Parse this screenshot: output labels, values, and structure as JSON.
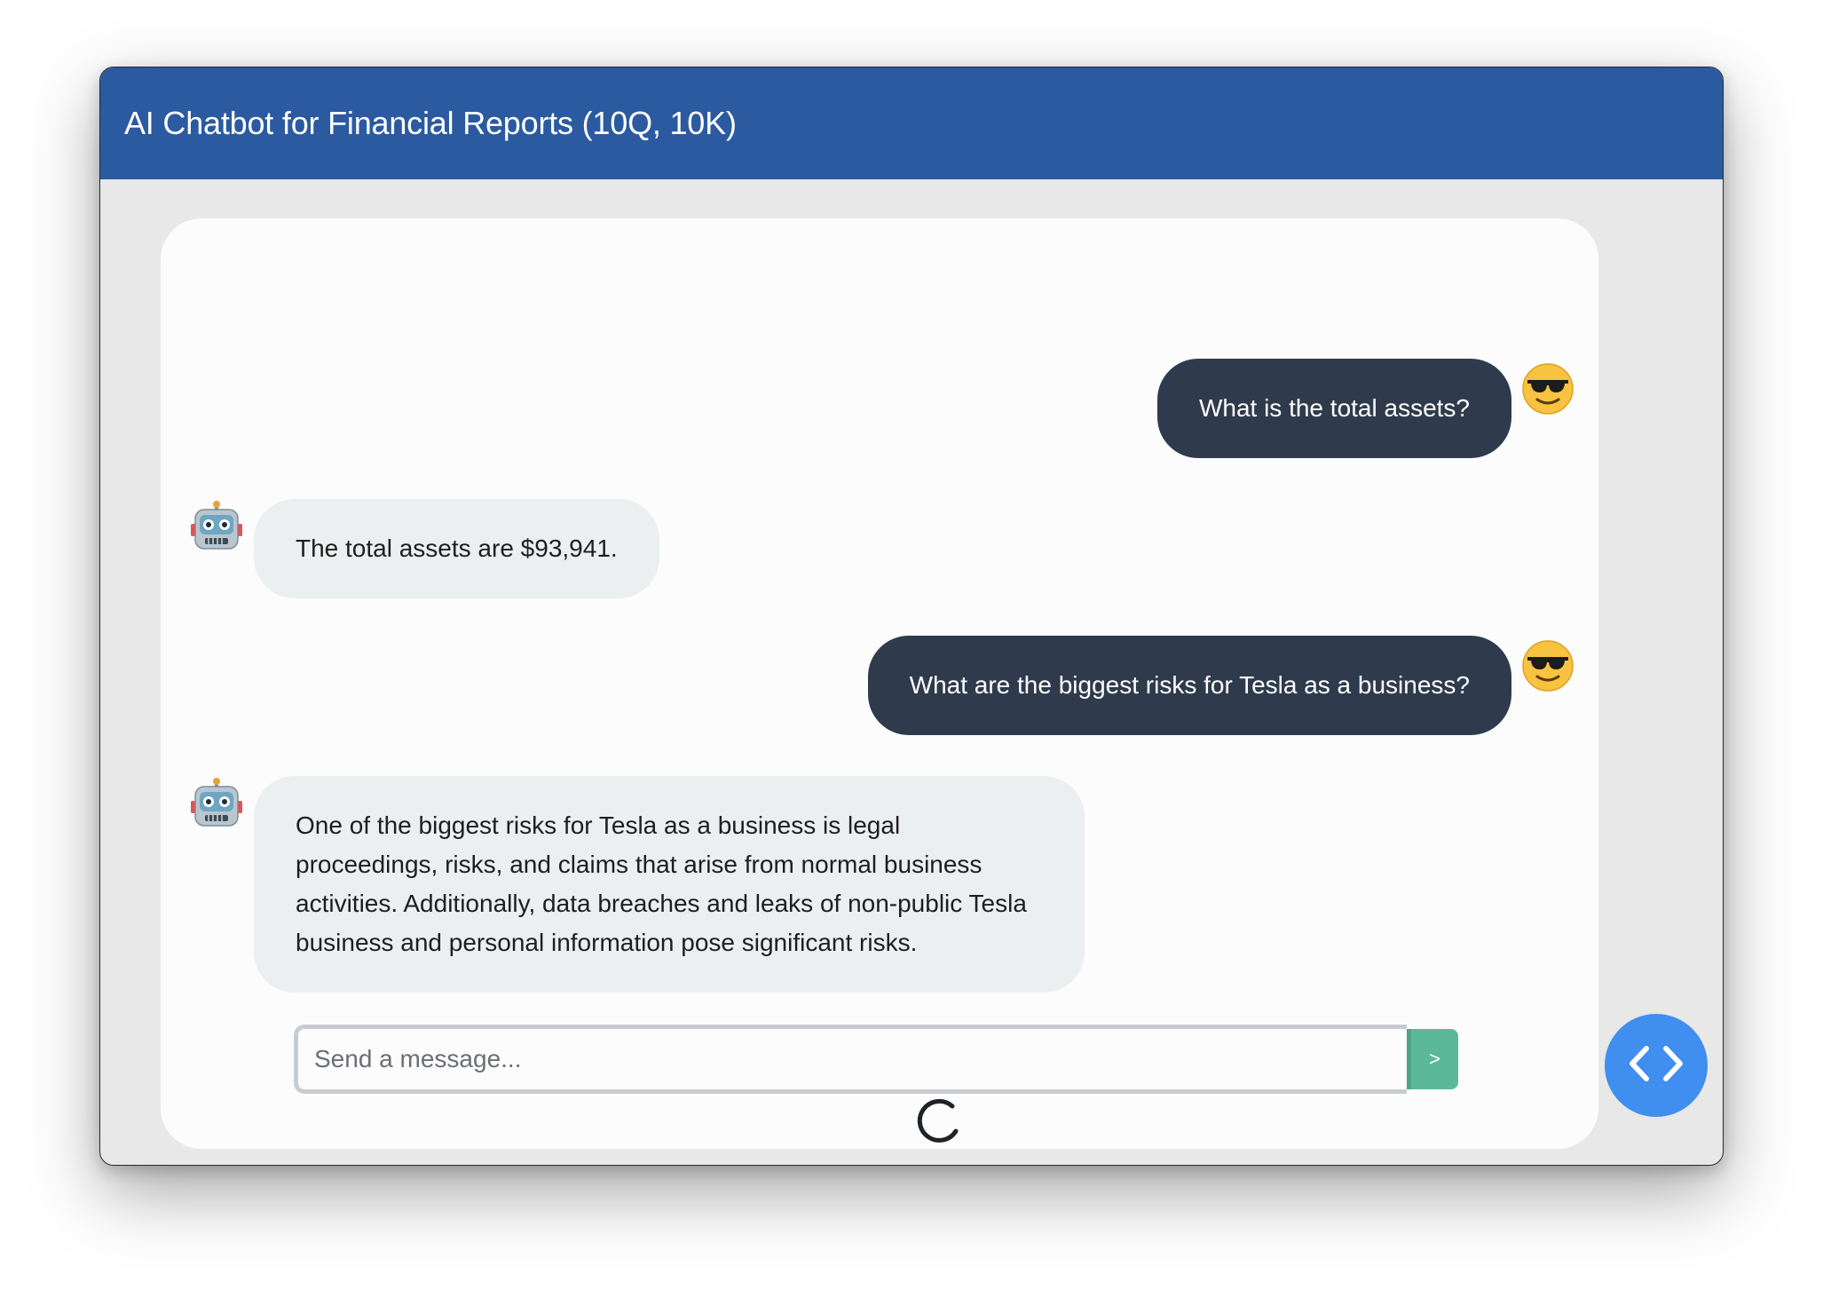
{
  "header": {
    "title": "AI Chatbot for Financial Reports (10Q, 10K)"
  },
  "messages": [
    {
      "role": "user",
      "text": "What is the total assets?",
      "avatar": "sunglasses-face-icon"
    },
    {
      "role": "bot",
      "text": "The total assets are $93,941.",
      "avatar": "robot-icon"
    },
    {
      "role": "user",
      "text": "What are the biggest risks for Tesla as a business?",
      "avatar": "sunglasses-face-icon"
    },
    {
      "role": "bot",
      "text": "One of the biggest risks for Tesla as a business is legal proceedings, risks, and claims that arise from normal business activities. Additionally, data breaches and leaks of non-public Tesla business and personal information pose significant risks.",
      "avatar": "robot-icon"
    }
  ],
  "composer": {
    "placeholder": "Send a message...",
    "value": "",
    "send_label": ">"
  },
  "status": {
    "loading_icon": "spinner-icon"
  },
  "fab": {
    "icon": "code-brackets-icon"
  },
  "colors": {
    "header": "#2b5aa0",
    "user_bubble": "#2f3b4c",
    "bot_bubble": "#eceff0",
    "send_button": "#5bb99a",
    "fab": "#3f8ef0"
  }
}
